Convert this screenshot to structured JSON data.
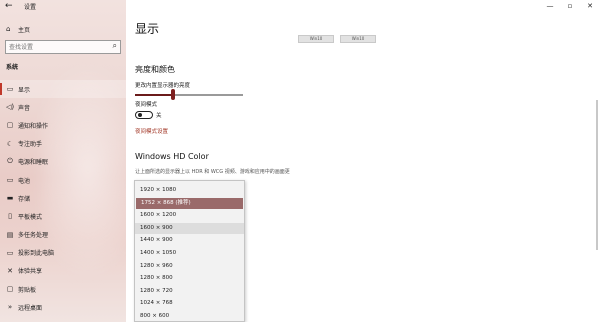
{
  "titlebar": {
    "back_icon": "back-arrow-icon",
    "title": "设置"
  },
  "window_controls": {
    "minimize": "—",
    "maximize": "▫",
    "close": "✕"
  },
  "home": {
    "icon": "home-icon",
    "label": "主页"
  },
  "search": {
    "placeholder": "查找设置",
    "icon": "search-icon"
  },
  "section": {
    "label": "系统"
  },
  "nav": [
    {
      "label": "显示",
      "icon": "monitor-icon",
      "glyph": "▭",
      "active": true
    },
    {
      "label": "声音",
      "icon": "speaker-icon",
      "glyph": "◁)"
    },
    {
      "label": "通知和操作",
      "icon": "notification-icon",
      "glyph": "▢"
    },
    {
      "label": "专注助手",
      "icon": "moon-icon",
      "glyph": "☾"
    },
    {
      "label": "电源和睡眠",
      "icon": "power-icon",
      "glyph": "⏻"
    },
    {
      "label": "电池",
      "icon": "battery-icon",
      "glyph": "▭"
    },
    {
      "label": "存储",
      "icon": "storage-icon",
      "glyph": "▬"
    },
    {
      "label": "平板模式",
      "icon": "tablet-icon",
      "glyph": "▯"
    },
    {
      "label": "多任务处理",
      "icon": "multitask-icon",
      "glyph": "▤"
    },
    {
      "label": "投影到此电脑",
      "icon": "projector-icon",
      "glyph": "▭"
    },
    {
      "label": "体验共享",
      "icon": "share-icon",
      "glyph": "✕"
    },
    {
      "label": "剪贴板",
      "icon": "clipboard-icon",
      "glyph": "▢"
    },
    {
      "label": "远程桌面",
      "icon": "remote-icon",
      "glyph": "»"
    }
  ],
  "main": {
    "title": "显示",
    "monitors": [
      "Win10",
      "Win10"
    ],
    "brightness_heading": "亮度和颜色",
    "brightness_label": "更改内置显示器的亮度",
    "brightness_value": 0.35,
    "night_light_label": "夜间模式",
    "night_light_state": "关",
    "night_light_link": "夜间模式设置",
    "hd_heading": "Windows HD Color",
    "hd_desc": "让上面所选的显示器上以 HDR 和 WCG 视频、游戏和应用中的画面更"
  },
  "resolution_options": [
    "1920 × 1080",
    "1752 × 868 (推荐)",
    "1600 × 1200",
    "1600 × 900",
    "1440 × 900",
    "1400 × 1050",
    "1280 × 960",
    "1280 × 800",
    "1280 × 720",
    "1024 × 768",
    "800 × 600"
  ],
  "colors": {
    "accent": "#7d1f1f",
    "link": "#a33a2a",
    "selected": "#9a6a6a"
  }
}
